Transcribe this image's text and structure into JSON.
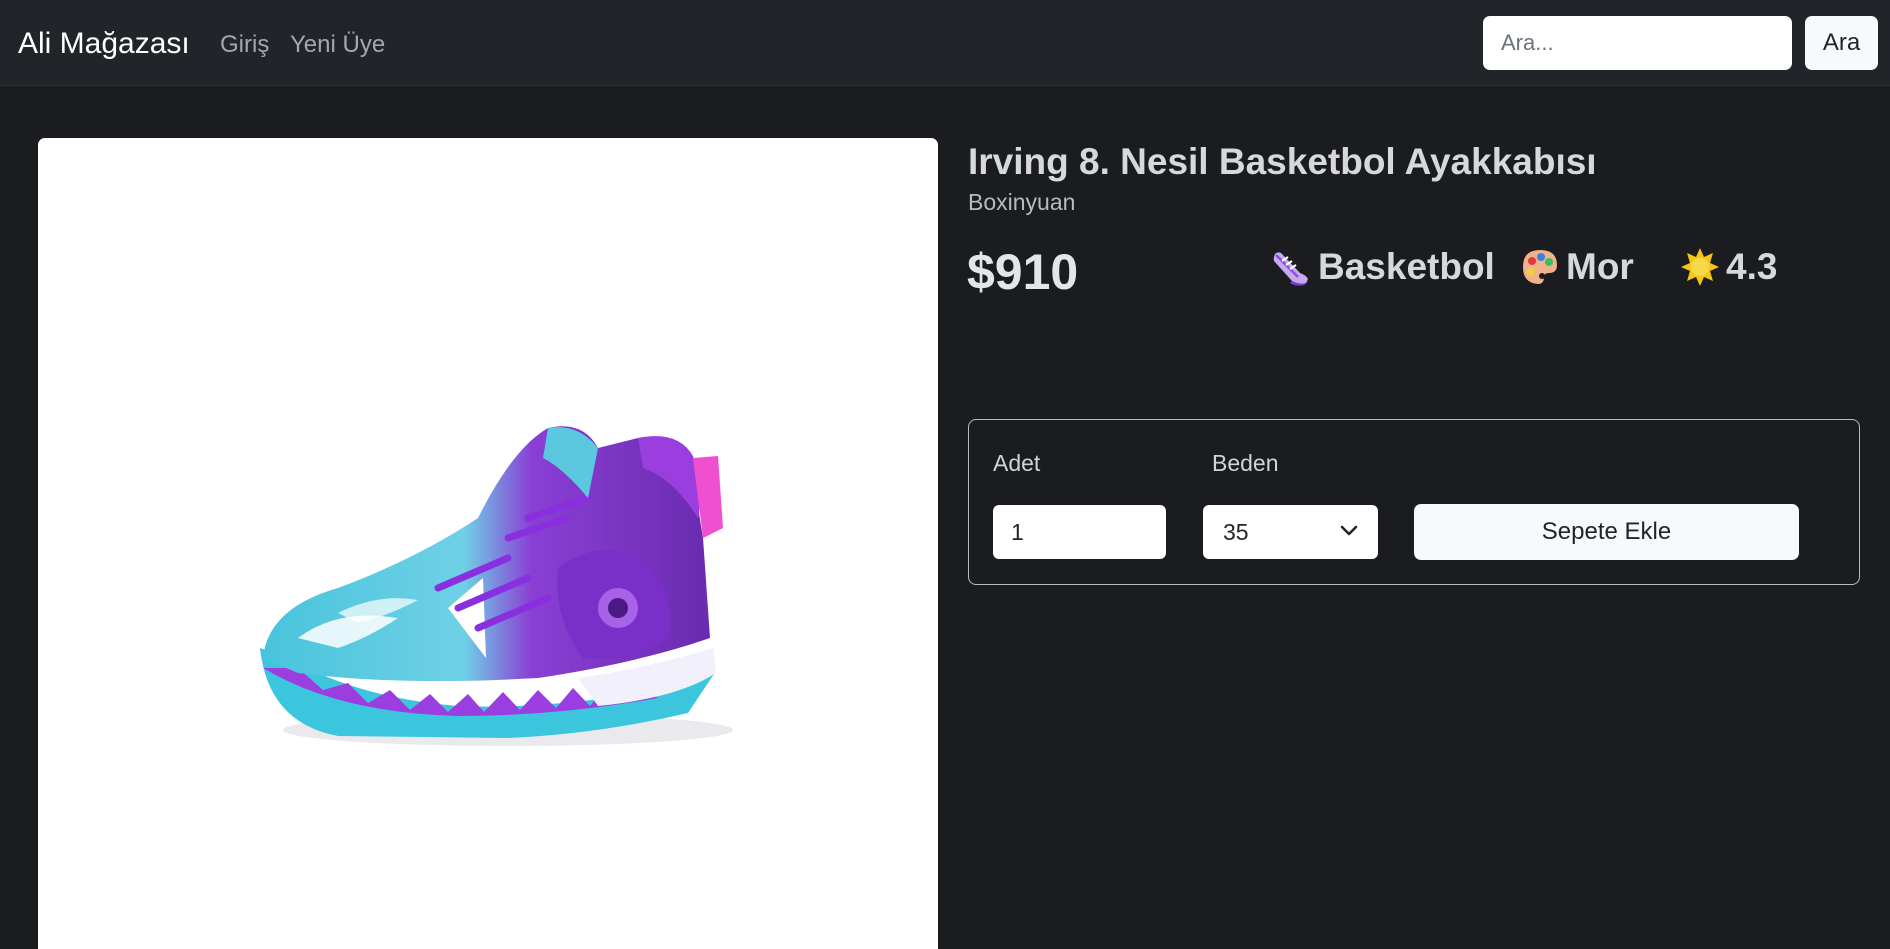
{
  "navbar": {
    "brand": "Ali Mağazası",
    "links": {
      "login": "Giriş",
      "register": "Yeni Üye"
    },
    "search": {
      "placeholder": "Ara...",
      "value": "",
      "button_label": "Ara"
    }
  },
  "product": {
    "title": "Irving 8. Nesil Basketbol Ayakkabısı",
    "brand": "Boxinyuan",
    "price": "$910",
    "image_icon": "basketball-shoe-photo",
    "attributes": {
      "category": {
        "icon": "sneaker-icon",
        "label": "Basketbol"
      },
      "color": {
        "icon": "palette-icon",
        "label": "Mor"
      },
      "rating": {
        "icon": "sun-icon",
        "label": "4.3"
      }
    }
  },
  "cart_form": {
    "quantity_label": "Adet",
    "quantity_value": "1",
    "size_label": "Beden",
    "size_value": "35",
    "add_button_label": "Sepete Ekle"
  },
  "colors": {
    "page_background": "#1b1c20",
    "navbar_background": "#212429",
    "accent_purple": "#9b3ee0",
    "accent_cyan": "#3cc6de",
    "accent_pink": "#f04fd0"
  }
}
